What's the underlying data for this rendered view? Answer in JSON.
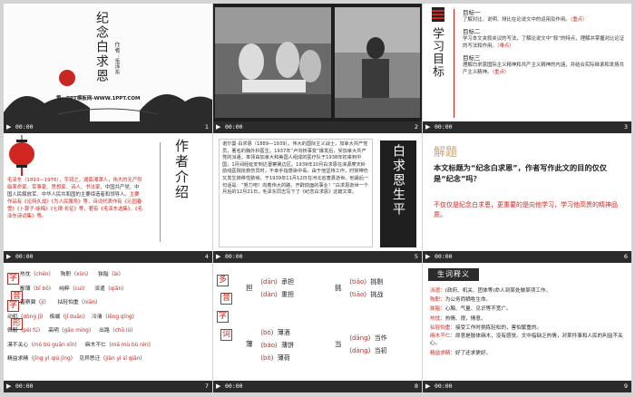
{
  "slides": [
    {
      "time": "00:00",
      "num": "1",
      "title": "纪念白求恩",
      "author": "作者：毛泽东",
      "footer": "第一PPT模板网-WWW.1PPT.COM"
    },
    {
      "time": "00:00",
      "num": "2"
    },
    {
      "time": "00:00",
      "num": "3",
      "heading": "学习目标",
      "goals": [
        {
          "label": "目标一",
          "text": "了解对比、说明、排比在论说文中的运用及作用。",
          "tag": "（重点）"
        },
        {
          "label": "目标二",
          "text": "学习本文夹叙夹议的写法，了解论说文中“叙”的特点，理解并掌握对比论证的写法和作用。",
          "tag": "（难点）"
        },
        {
          "label": "目标三",
          "text": "理解白求恩国际主义精神和共产主义精神的内涵，并结合实际继承和发扬共产主义精神。",
          "tag": "（重点）"
        }
      ]
    },
    {
      "time": "00:00",
      "num": "4",
      "heading": "作者介绍",
      "text_red": "毛泽东（1893—1976），字润之，湖南湘潭人，伟大的无产阶级革命家、军事家、思想家、诗人、书法家，",
      "text_black": "中国共产党、中国人民解放军、中华人民共和国的主要缔造者和领导人。",
      "text_red2": "主要作品有《论持久战》《为人民服务》等，诗词代表作有《沁园春·雪》《卜算子·咏梅》《七律·长征》等，著有《毛泽东选集》、《毛泽东诗词集》等。"
    },
    {
      "time": "00:00",
      "num": "5",
      "heading": "白求恩生平",
      "text": "诺尔曼·白求恩（1889—1939）。伟大的国际主义战士，加拿大共产党员，著名的胸外科医生。1937年“卢沟桥事变”爆发后，受加拿大共产党的派遣，率领由加拿大和美国人组成的医疗队于1938年初来到中国，1月间经延安到达晋察冀边区。1939年10月白求恩在涞源摩天岭前线医院抢救伤员时，不幸手指感染中毒，由于他坚持工作，时常带伤又发生转移性脓疡，于1939年11月12日在河北省唐县逝世。他最后一句话是：“努力吧！向着伟大的路，开辟前面的事业！”白求恩逝世一个月后的12月21日，毛泽东同志写下了《纪念白求恩》这篇文章。"
    },
    {
      "time": "00:00",
      "num": "6",
      "heading": "解题",
      "question": "本文标题为“纪念白求恩”，作者写作此文的目的仅仅是“纪念”吗？",
      "answer": "不仅仅是纪念白求恩，更重要的是向他学习，学习他高贵的精神品质。"
    },
    {
      "time": "00:00",
      "num": "7",
      "boxes": [
        "字",
        "音",
        "字",
        "形"
      ],
      "rows": [
        [
          {
            "w": "热忱",
            "p": "chén"
          },
          {
            "w": "殉职",
            "p": "xùn"
          },
          {
            "w": "狭隘",
            "p": "ài"
          }
        ],
        [
          {
            "w": "鄙薄",
            "p": "bǐ bó"
          },
          {
            "w": "纯粹",
            "p": "cuì"
          },
          {
            "w": "派遣",
            "p": "qiǎn"
          }
        ],
        [
          {
            "w": "晋察冀",
            "p": "jì"
          },
          {
            "w": "拈轻怕重",
            "p": "niān"
          }
        ],
        [
          {
            "w": "动机",
            "p": "dòng jī"
          },
          {
            "w": "极端",
            "p": "jí duān"
          },
          {
            "w": "冷清",
            "p": "lěng qīng"
          }
        ],
        [
          {
            "w": "佩服",
            "p": "pèi fú"
          },
          {
            "w": "高明",
            "p": "gāo míng"
          },
          {
            "w": "出路",
            "p": "chū lù"
          }
        ],
        [
          {
            "w": "漠不关心",
            "p": "mò bù guān xīn"
          },
          {
            "w": "麻木不仁",
            "p": "má mù bù rén"
          }
        ],
        [
          {
            "w": "精益求精",
            "p": "jīng yì qiú jīng"
          },
          {
            "w": "见异思迁",
            "p": "jiàn yì sī qiān"
          }
        ]
      ]
    },
    {
      "time": "00:00",
      "num": "8",
      "boxes": [
        "多",
        "音",
        "字",
        "词"
      ],
      "groups": [
        {
          "char": "担",
          "items": [
            {
              "p": "dān",
              "w": "承担"
            },
            {
              "p": "dàn",
              "w": "重担"
            }
          ]
        },
        {
          "char": "挑",
          "items": [
            {
              "p": "tiǎo",
              "w": "挑剔"
            },
            {
              "p": "tiāo",
              "w": "挑战"
            }
          ]
        },
        {
          "char": "薄",
          "items": [
            {
              "p": "bó",
              "w": "薄酒"
            },
            {
              "p": "báo",
              "w": "薄饼"
            },
            {
              "p": "bò",
              "w": "薄荷"
            }
          ]
        },
        {
          "char": "当",
          "items": [
            {
              "p": "dāng",
              "w": "当作"
            },
            {
              "p": "dàng",
              "w": "当初"
            }
          ]
        }
      ]
    },
    {
      "time": "00:00",
      "num": "9",
      "heading": "生词释义",
      "defs": [
        {
          "term": "派遣：",
          "def": "(政府、机关、团体等)命人到某处做某项工作。"
        },
        {
          "term": "殉职：",
          "def": "为公务而牺牲生命。"
        },
        {
          "term": "狭隘：",
          "def": "心胸、气量、见识等不宽广。"
        },
        {
          "term": "热忱：",
          "def": "热情、很，情意。"
        },
        {
          "term": "拈轻怕重：",
          "def": "接受工作时挑拣轻松的，害怕繁重的。"
        },
        {
          "term": "麻木不仁：",
          "def": "原意是肢体麻木，没有感觉。文中指缺乏热情，对某件事和人民的利益不关心。"
        },
        {
          "term": "精益求精：",
          "def": "好了还求更好。"
        }
      ]
    }
  ]
}
